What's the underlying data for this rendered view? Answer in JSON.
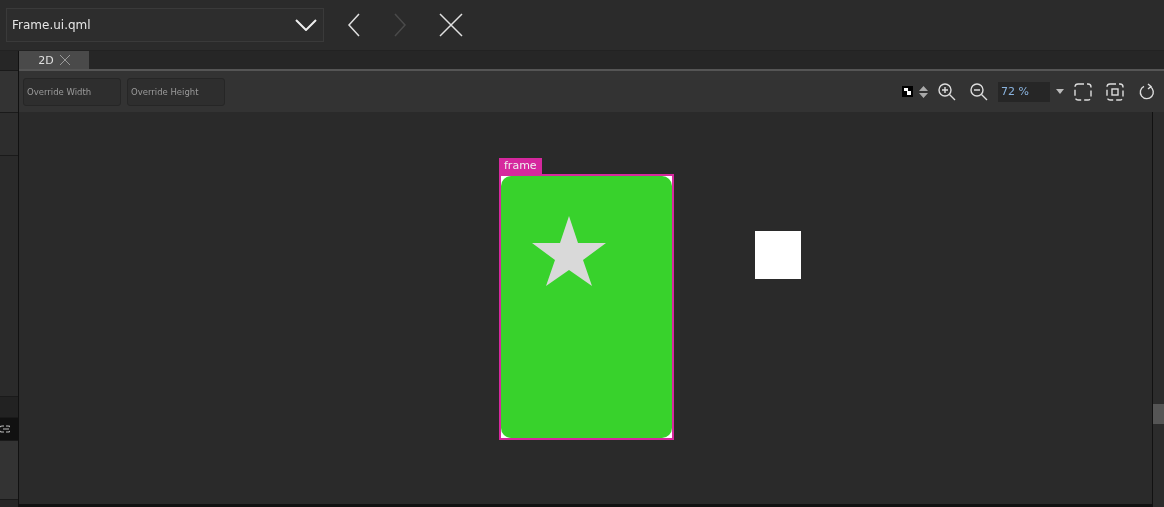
{
  "file_selector": {
    "value": "Frame.ui.qml"
  },
  "nav_buttons": [
    {
      "kind": "back",
      "disabled": false
    },
    {
      "kind": "forward",
      "disabled": true
    },
    {
      "kind": "close",
      "disabled": false
    }
  ],
  "tabs": [
    {
      "label": "2D",
      "selected": true
    }
  ],
  "toolbar": {
    "override_fields": [
      {
        "placeholder": "Override Width"
      },
      {
        "placeholder": "Override Height"
      }
    ],
    "zoom": {
      "value": "72 %"
    }
  },
  "canvas": {
    "frame": {
      "label": "frame",
      "selected": true
    }
  }
}
